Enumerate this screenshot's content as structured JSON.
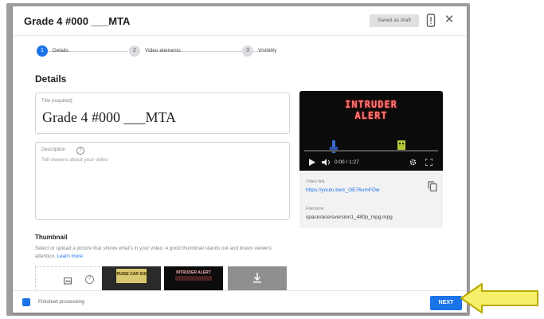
{
  "dialog": {
    "title": "Grade 4 #000 ___MTA",
    "save_draft_label": "Saved as draft",
    "close_glyph": "✕"
  },
  "stepper": {
    "steps": [
      {
        "num": "1",
        "label": "Details",
        "active": true
      },
      {
        "num": "2",
        "label": "Video elements",
        "active": false
      },
      {
        "num": "3",
        "label": "Visibility",
        "active": false
      }
    ]
  },
  "details": {
    "heading": "Details",
    "title_field": {
      "label": "Title (required)",
      "value": "Grade 4 #000 ___MTA"
    },
    "description_field": {
      "label": "Description",
      "placeholder": "Tell viewers about your video",
      "help_glyph": "?"
    }
  },
  "video": {
    "overlay_line1": "INTRUDER",
    "overlay_line2": "ALERT",
    "time": "0:00 / 1:27",
    "progress_fraction": 0.0,
    "link_label": "Video link",
    "link_value": "https://youtu.be/c_OE76umFOw",
    "filename_label": "Filename",
    "filename_value": "spaceracersversion1_480p_mpg.mpg"
  },
  "thumbnail": {
    "heading": "Thumbnail",
    "description": "Select or upload a picture that shows what's in your video. A good thumbnail stands out and draws viewers' attention.",
    "learn_more": "Learn more",
    "help_glyph": "?",
    "thumb1_text": "CRUISE CAR SHIP",
    "thumb2_text": "INTRUDER ALERT"
  },
  "footer": {
    "status": "Finished processing",
    "next_label": "NEXT"
  },
  "colors": {
    "accent": "#1a73e8",
    "arrow_fill": "#f5ef6a",
    "arrow_stroke": "#b9a900",
    "video_overlay": "#ff7a7a"
  },
  "icons": {
    "header_alert": "alert-icon",
    "close": "close-icon",
    "copy": "copy-icon",
    "upload": "upload-icon",
    "footer": "check-square-icon",
    "arrow": "pointer-arrow-icon"
  }
}
